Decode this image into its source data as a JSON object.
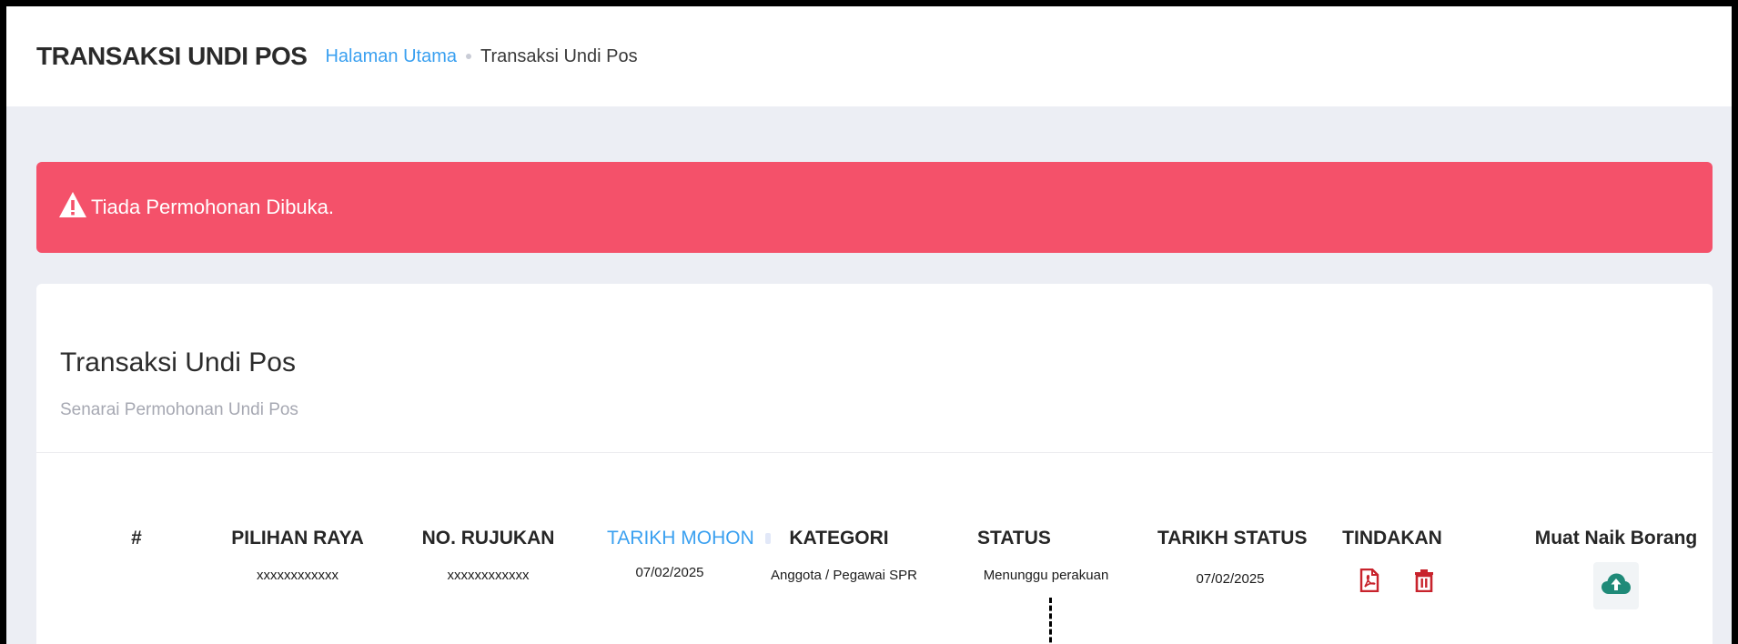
{
  "header": {
    "page_title": "TRANSAKSI UNDI POS",
    "breadcrumb": {
      "home": "Halaman Utama",
      "current": "Transaksi Undi Pos"
    }
  },
  "alert": {
    "icon": "warning-icon",
    "message": "Tiada Permohonan Dibuka."
  },
  "card": {
    "title": "Transaksi Undi Pos",
    "subtitle": "Senarai Permohonan Undi Pos"
  },
  "table": {
    "columns": {
      "num": "#",
      "pilihan_raya": "PILIHAN RAYA",
      "no_rujukan": "NO. RUJUKAN",
      "tarikh_mohon": "TARIKH MOHON",
      "kategori": "KATEGORI",
      "status": "STATUS",
      "tarikh_status": "TARIKH STATUS",
      "tindakan": "TINDAKAN",
      "muat_naik": "Muat Naik Borang"
    },
    "rows": [
      {
        "pilihan_raya": "xxxxxxxxxxxx",
        "no_rujukan": "xxxxxxxxxxxx",
        "tarikh_mohon": "07/02/2025",
        "kategori": "Anggota / Pegawai SPR",
        "status": "Menunggu perakuan",
        "tarikh_status": "07/02/2025",
        "actions": [
          "pdf-icon",
          "trash-icon"
        ],
        "upload": "cloud-upload-icon"
      }
    ]
  },
  "colors": {
    "accent": "#3aa0f0",
    "alert_bg": "#f4516a",
    "action_red": "#c8232c",
    "upload_green": "#1f8a78"
  }
}
